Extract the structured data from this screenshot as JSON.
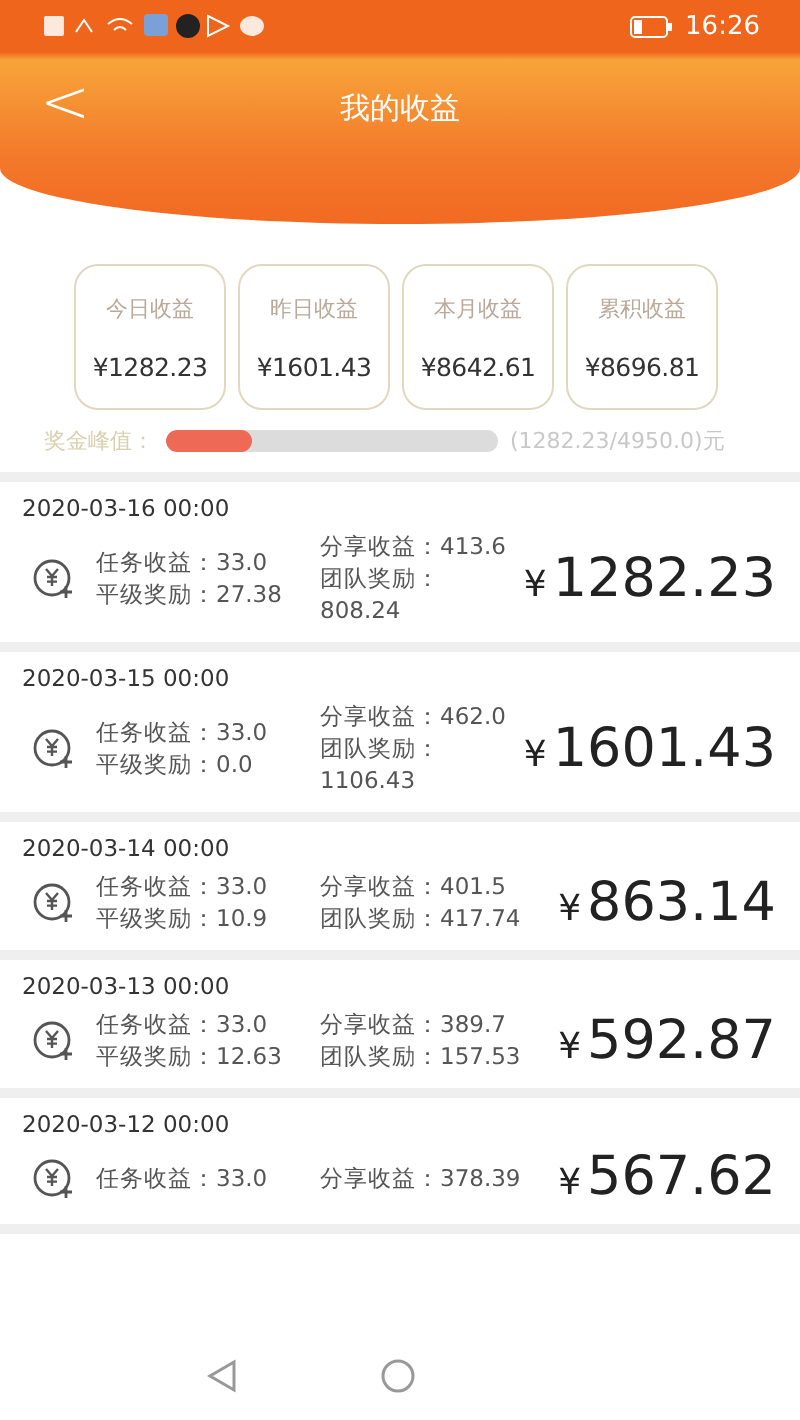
{
  "status_bar": {
    "time": "16:26"
  },
  "header": {
    "back": "<",
    "title": "我的收益"
  },
  "summary_cards": [
    {
      "label": "今日收益",
      "value": "¥1282.23"
    },
    {
      "label": "昨日收益",
      "value": "¥1601.43"
    },
    {
      "label": "本月收益",
      "value": "¥8642.61"
    },
    {
      "label": "累积收益",
      "value": "¥8696.81"
    }
  ],
  "bonus_peak": {
    "label": "奖金峰值：",
    "level": 0.26,
    "reading": "(1282.23/4950.0)元"
  },
  "records": [
    {
      "date": "2020-03-16 00:00",
      "task": {
        "label": "任务收益：",
        "value": "33.0"
      },
      "level_reward": {
        "label": "平级奖励：",
        "value": "27.38"
      },
      "share": {
        "label": "分享收益：",
        "value": "413.6"
      },
      "team": {
        "label": "团队奖励：",
        "value": "808.24"
      },
      "currency": "¥",
      "amount": "1282.23"
    },
    {
      "date": "2020-03-15 00:00",
      "task": {
        "label": "任务收益：",
        "value": "33.0"
      },
      "level_reward": {
        "label": "平级奖励：",
        "value": "0.0"
      },
      "share": {
        "label": "分享收益：",
        "value": "462.0"
      },
      "team": {
        "label": "团队奖励：",
        "value": "1106.43"
      },
      "currency": "¥",
      "amount": "1601.43"
    },
    {
      "date": "2020-03-14 00:00",
      "task": {
        "label": "任务收益：",
        "value": "33.0"
      },
      "level_reward": {
        "label": "平级奖励：",
        "value": "10.9"
      },
      "share": {
        "label": "分享收益：",
        "value": "401.5"
      },
      "team": {
        "label": "团队奖励：",
        "value": "417.74"
      },
      "currency": "¥",
      "amount": "863.14"
    },
    {
      "date": "2020-03-13 00:00",
      "task": {
        "label": "任务收益：",
        "value": "33.0"
      },
      "level_reward": {
        "label": "平级奖励：",
        "value": "12.63"
      },
      "share": {
        "label": "分享收益：",
        "value": "389.7"
      },
      "team": {
        "label": "团队奖励：",
        "value": "157.53"
      },
      "currency": "¥",
      "amount": "592.87"
    },
    {
      "date": "2020-03-12 00:00",
      "task": {
        "label": "任务收益：",
        "value": "33.0"
      },
      "share": {
        "label": "分享收益：",
        "value": "378.39"
      },
      "currency": "¥",
      "amount": "567.62"
    }
  ]
}
